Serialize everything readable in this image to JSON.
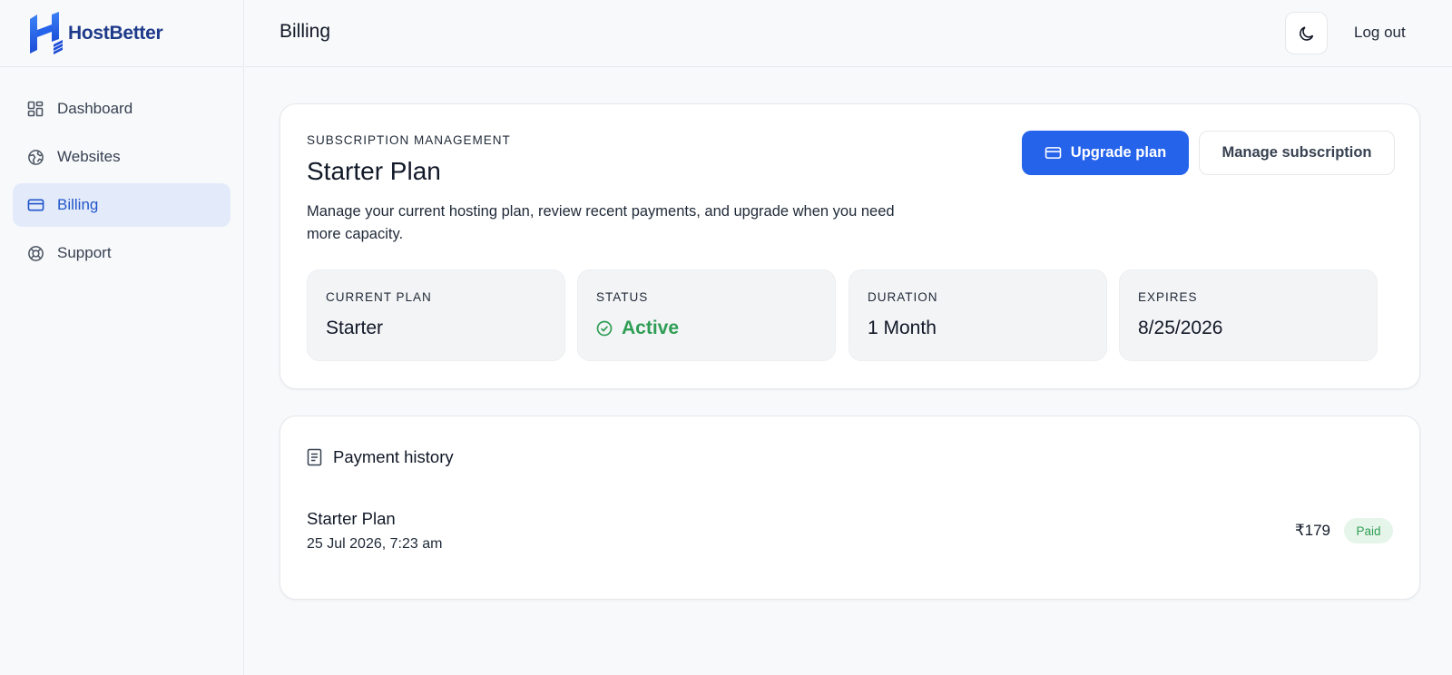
{
  "brand": {
    "name": "HostBetter",
    "logo_icon": "hostbetter-logo"
  },
  "sidebar": {
    "items": [
      {
        "label": "Dashboard",
        "icon": "grid-icon",
        "active": false
      },
      {
        "label": "Websites",
        "icon": "globe-icon",
        "active": false
      },
      {
        "label": "Billing",
        "icon": "credit-card-icon",
        "active": true
      },
      {
        "label": "Support",
        "icon": "lifebuoy-icon",
        "active": false
      }
    ]
  },
  "header": {
    "title": "Billing",
    "theme_toggle_icon": "moon-icon",
    "logout_label": "Log out"
  },
  "subscription": {
    "eyebrow": "SUBSCRIPTION MANAGEMENT",
    "plan_title": "Starter Plan",
    "description": "Manage your current hosting plan, review recent payments, and upgrade when you need more capacity.",
    "upgrade_label": "Upgrade plan",
    "manage_label": "Manage subscription",
    "stats": [
      {
        "label": "CURRENT PLAN",
        "value": "Starter"
      },
      {
        "label": "STATUS",
        "value": "Active"
      },
      {
        "label": "DURATION",
        "value": "1 Month"
      },
      {
        "label": "EXPIRES",
        "value": "8/25/2026"
      }
    ]
  },
  "payment_history": {
    "title": "Payment history",
    "items": [
      {
        "name": "Starter Plan",
        "date": "25 Jul 2026, 7:23 am",
        "amount": "₹179",
        "status": "Paid"
      }
    ]
  },
  "colors": {
    "primary": "#2563eb",
    "active_nav_bg": "#e3ebfb",
    "active_nav_text": "#2255c9",
    "success": "#2f9e55",
    "success_bg": "#e6f5ea",
    "page_bg": "#f8f9fb",
    "stat_bg": "#f3f4f6"
  }
}
